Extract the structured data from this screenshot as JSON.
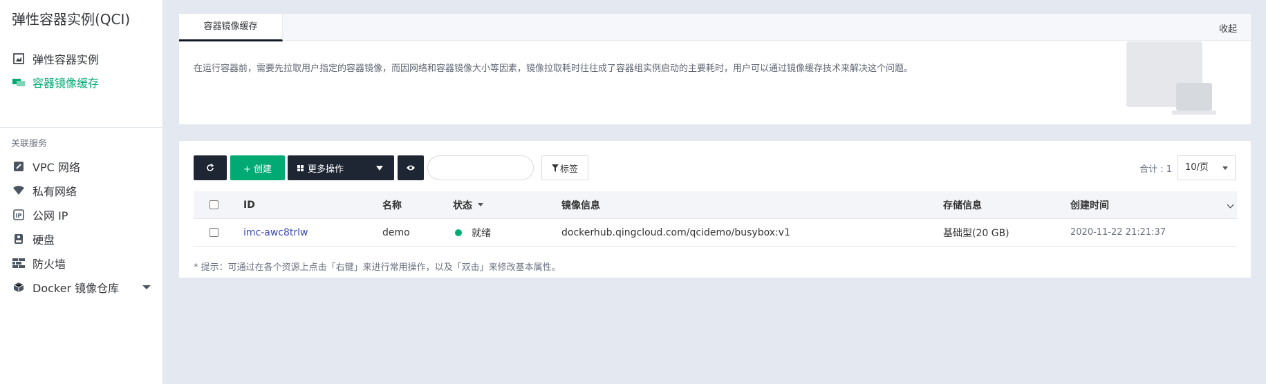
{
  "sidebar": {
    "title": "弹性容器实例(QCI)",
    "items": [
      {
        "label": "弹性容器实例",
        "icon": "instance-icon"
      },
      {
        "label": "容器镜像缓存",
        "icon": "image-cache-icon"
      }
    ],
    "group_label": "关联服务",
    "related": [
      {
        "label": "VPC 网络",
        "icon": "vpc-icon"
      },
      {
        "label": "私有网络",
        "icon": "wifi-icon"
      },
      {
        "label": "公网 IP",
        "icon": "ip-icon"
      },
      {
        "label": "硬盘",
        "icon": "disk-icon"
      },
      {
        "label": "防火墙",
        "icon": "firewall-icon"
      },
      {
        "label": "Docker 镜像仓库",
        "icon": "docker-box-icon"
      }
    ]
  },
  "info": {
    "tab": "容器镜像缓存",
    "collapse": "收起",
    "description": "在运行容器前，需要先拉取用户指定的容器镜像，而因网络和容器镜像大小等因素，镜像拉取耗时往往成了容器组实例启动的主要耗时，用户可以通过镜像缓存技术来解决这个问题。"
  },
  "toolbar": {
    "create": "+ 创建",
    "more": "更多操作",
    "tag": "标签",
    "search_placeholder": "",
    "total": "合计 : 1",
    "page_size": "10/页"
  },
  "table": {
    "columns": [
      "ID",
      "名称",
      "状态",
      "镜像信息",
      "存储信息",
      "创建时间"
    ],
    "rows": [
      {
        "id": "imc-awc8trlw",
        "name": "demo",
        "status": "就绪",
        "image": "dockerhub.qingcloud.com/qcidemo/busybox:v1",
        "storage": "基础型(20 GB)",
        "created": "2020-11-22 21:21:37"
      }
    ],
    "hint": "* 提示：可通过在各个资源上点击「右键」来进行常用操作，以及「双击」来修改基本属性。"
  },
  "colors": {
    "accent": "#00aa72",
    "dark": "#1e2533",
    "link": "#3b48b8"
  }
}
